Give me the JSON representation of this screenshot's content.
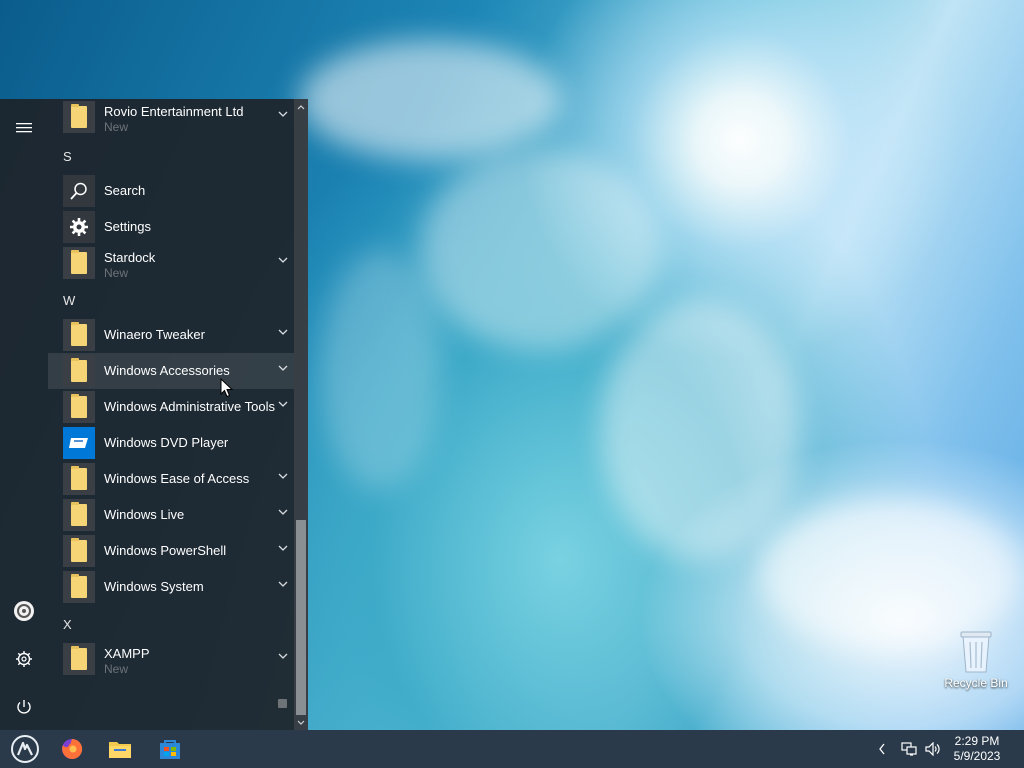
{
  "desktop": {
    "recycle_bin_label": "Recycle Bin"
  },
  "start_menu": {
    "apps": [
      {
        "kind": "app",
        "label": "Rovio Entertainment Ltd",
        "sub": "New",
        "icon": "folder-icon",
        "expandable": true
      },
      {
        "kind": "letter",
        "label": "S"
      },
      {
        "kind": "app",
        "label": "Search",
        "icon": "search-icon",
        "expandable": false
      },
      {
        "kind": "app",
        "label": "Settings",
        "icon": "gear-icon",
        "expandable": false
      },
      {
        "kind": "app",
        "label": "Stardock",
        "sub": "New",
        "icon": "folder-icon",
        "expandable": true
      },
      {
        "kind": "letter",
        "label": "W"
      },
      {
        "kind": "app",
        "label": "Winaero Tweaker",
        "icon": "folder-icon",
        "expandable": true
      },
      {
        "kind": "app",
        "label": "Windows Accessories",
        "icon": "folder-icon",
        "expandable": true,
        "hover": true
      },
      {
        "kind": "app",
        "label": "Windows Administrative Tools",
        "icon": "folder-icon",
        "expandable": true
      },
      {
        "kind": "app",
        "label": "Windows DVD Player",
        "icon": "dvd-player-icon",
        "expandable": false
      },
      {
        "kind": "app",
        "label": "Windows Ease of Access",
        "icon": "folder-icon",
        "expandable": true
      },
      {
        "kind": "app",
        "label": "Windows Live",
        "icon": "folder-icon",
        "expandable": true
      },
      {
        "kind": "app",
        "label": "Windows PowerShell",
        "icon": "folder-icon",
        "expandable": true
      },
      {
        "kind": "app",
        "label": "Windows System",
        "icon": "folder-icon",
        "expandable": true
      },
      {
        "kind": "letter",
        "label": "X"
      },
      {
        "kind": "app",
        "label": "XAMPP",
        "sub": "New",
        "icon": "folder-icon",
        "expandable": true
      }
    ]
  },
  "taskbar": {
    "pinned": [
      "start-button",
      "firefox",
      "file-explorer",
      "app-store"
    ],
    "clock_time": "2:29 PM",
    "clock_date": "5/9/2023"
  },
  "colors": {
    "accent": "#0078d7",
    "folder": "#f6d577",
    "taskbar": "#2a3a4a",
    "menu_bg": "#1e242a"
  }
}
